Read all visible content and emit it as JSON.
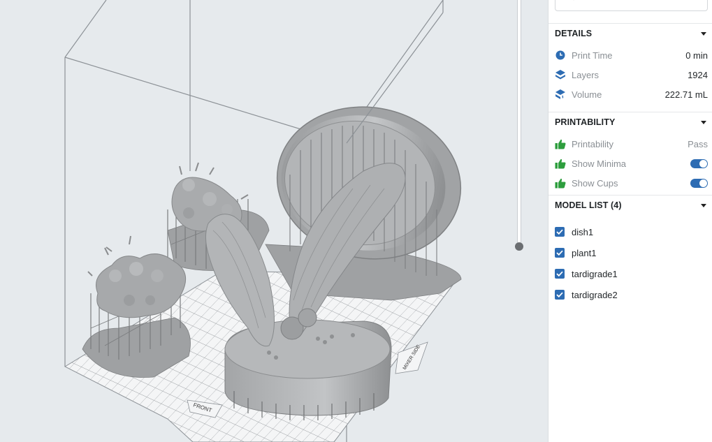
{
  "viewport": {
    "plate_front_label": "FRONT",
    "plate_side_label": "MIXER SIDE"
  },
  "details": {
    "title": "DETAILS",
    "print_time": {
      "label": "Print Time",
      "value": "0 min"
    },
    "layers": {
      "label": "Layers",
      "value": "1924"
    },
    "volume": {
      "label": "Volume",
      "value": "222.71 mL"
    }
  },
  "printability": {
    "title": "PRINTABILITY",
    "status": {
      "label": "Printability",
      "value": "Pass"
    },
    "show_minima": {
      "label": "Show Minima",
      "enabled": true
    },
    "show_cups": {
      "label": "Show Cups",
      "enabled": true
    }
  },
  "model_list": {
    "title": "MODEL LIST (4)",
    "models": [
      {
        "name": "dish1",
        "checked": true
      },
      {
        "name": "plant1",
        "checked": true
      },
      {
        "name": "tardigrade1",
        "checked": true
      },
      {
        "name": "tardigrade2",
        "checked": true
      }
    ]
  },
  "colors": {
    "accent": "#2d6cb3",
    "pass_green": "#2e9e3e",
    "viewport_bg": "#e6eaed"
  }
}
